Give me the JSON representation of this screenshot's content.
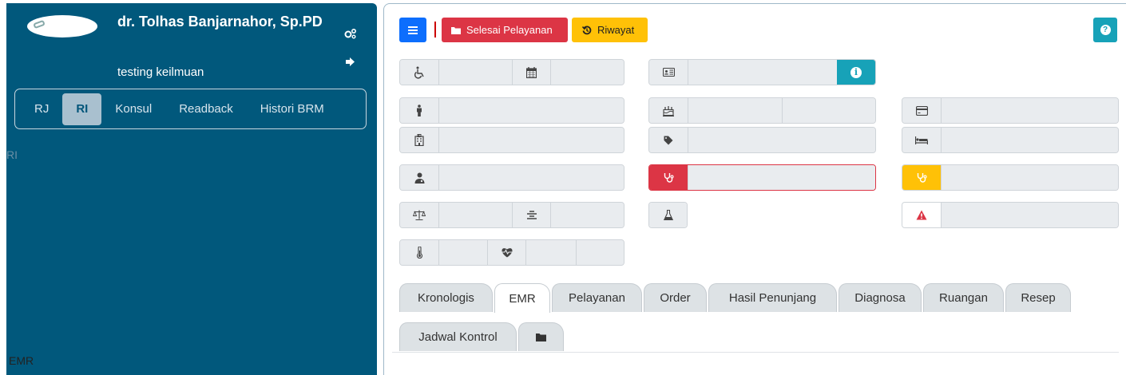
{
  "sidebar": {
    "doctor_name": "dr. Tolhas Banjarnahor, Sp.PD",
    "doctor_sub": "testing keilmuan",
    "icons": {
      "settings": "gears-icon",
      "logout": "sign-out-icon"
    },
    "tabs": [
      {
        "label": "RJ",
        "active": false
      },
      {
        "label": "RI",
        "active": true
      },
      {
        "label": "Konsul",
        "active": false
      },
      {
        "label": "Readback",
        "active": false
      },
      {
        "label": "Histori BRM",
        "active": false
      }
    ],
    "content": "RI"
  },
  "toolbar": {
    "selesai_label": "Selesai Pelayanan",
    "riwayat_label": "Riwayat",
    "help_label": "?"
  },
  "fields_icons": {
    "col1": [
      "wheelchair-icon",
      "calendar-icon",
      "person-icon",
      "hospital-icon",
      "doctor-icon",
      "scale-icon",
      "align-icon",
      "thermometer-icon",
      "heartbeat-icon"
    ],
    "col2": [
      "id-card-icon",
      "birthday-cake-icon",
      "tag-icon",
      "stethoscope-icon",
      "flask-icon"
    ],
    "col3": [
      "credit-card-icon",
      "bed-icon",
      "stethoscope-icon",
      "warning-icon"
    ]
  },
  "info_label": "i",
  "tabs": [
    {
      "label": "Kronologis"
    },
    {
      "label": "EMR"
    },
    {
      "label": "Pelayanan"
    },
    {
      "label": "Order"
    },
    {
      "label": "Hasil Penunjang"
    },
    {
      "label": "Diagnosa"
    },
    {
      "label": "Ruangan"
    },
    {
      "label": "Resep"
    },
    {
      "label": "Jadwal Kontrol"
    },
    {
      "label": "",
      "icon": "folder-icon"
    }
  ],
  "active_tab": "EMR",
  "tab_content": "EMR",
  "colors": {
    "sidebar_bg": "#01587c",
    "primary": "#0d6efd",
    "danger": "#dc3545",
    "warning": "#ffc107",
    "info": "#17a2b8"
  }
}
